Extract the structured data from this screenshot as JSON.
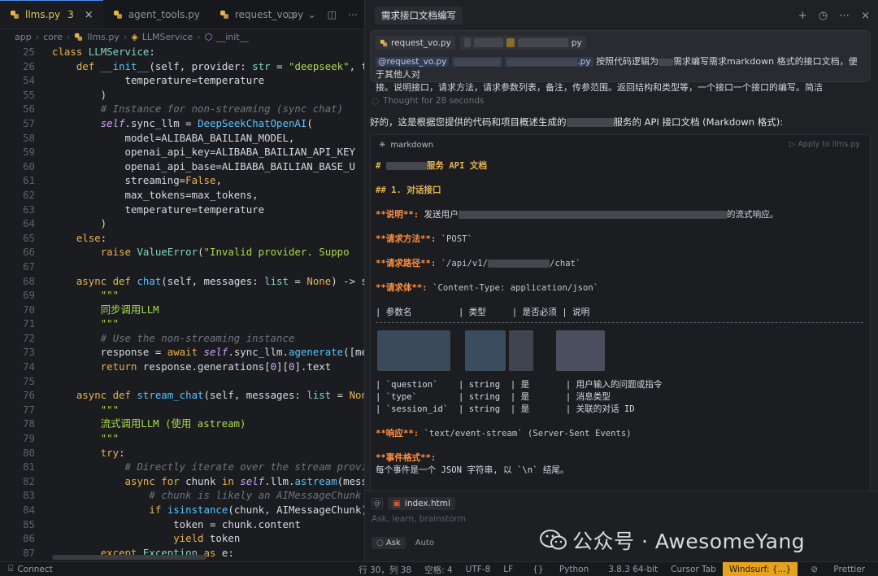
{
  "editor": {
    "tabs": [
      {
        "label": "llms.py",
        "badge": "3",
        "active": true
      },
      {
        "label": "agent_tools.py",
        "active": false
      },
      {
        "label": "request_vo.py",
        "active": false
      }
    ],
    "breadcrumb": [
      "app",
      "core",
      "llms.py",
      "LLMService",
      "__init__"
    ],
    "lines": [
      {
        "n": "25",
        "html": "<span class='kw'>class</span> <span class='cls'>LLMService</span>:"
      },
      {
        "n": "26",
        "html": "    <span class='kw'>def</span> <span class='fn'>__init__</span>(self, provider: <span class='cls'>str</span> = <span class='str'>\"deepseek\"</span>, t"
      },
      {
        "n": "54",
        "html": "            temperature=temperature"
      },
      {
        "n": "55",
        "html": "        )"
      },
      {
        "n": "56",
        "html": "        <span class='cm'># Instance for non-streaming (sync chat)</span>"
      },
      {
        "n": "57",
        "html": "        <span class='self'>self</span>.sync_llm = <span class='fn'>DeepSeekChatOpenAI</span>("
      },
      {
        "n": "58",
        "html": "            model=ALIBABA_BAILIAN_MODEL,"
      },
      {
        "n": "59",
        "html": "            openai_api_key=ALIBABA_BAILIAN_API_KEY"
      },
      {
        "n": "60",
        "html": "            openai_api_base=ALIBABA_BAILIAN_BASE_U"
      },
      {
        "n": "61",
        "html": "            streaming=<span class='bl'>False</span>,"
      },
      {
        "n": "62",
        "html": "            max_tokens=max_tokens,"
      },
      {
        "n": "63",
        "html": "            temperature=temperature"
      },
      {
        "n": "64",
        "html": "        )"
      },
      {
        "n": "65",
        "html": "    <span class='kw'>else</span>:"
      },
      {
        "n": "66",
        "html": "        <span class='kw'>raise</span> <span class='cls'>ValueError</span>(<span class='str'>\"Invalid provider. Suppo</span>"
      },
      {
        "n": "67",
        "html": ""
      },
      {
        "n": "68",
        "html": "    <span class='kw'>async def</span> <span class='fn'>chat</span>(self, messages: <span class='cls'>list</span> = <span class='bl'>None</span>) -&gt; st"
      },
      {
        "n": "69",
        "html": "        <span class='str'>\"\"\"</span>"
      },
      {
        "n": "70",
        "html": "        <span class='str'>同步调用LLM</span>"
      },
      {
        "n": "71",
        "html": "        <span class='str'>\"\"\"</span>"
      },
      {
        "n": "72",
        "html": "        <span class='cm'># Use the non-streaming instance</span>"
      },
      {
        "n": "73",
        "html": "        response = <span class='kw'>await</span> <span class='self'>self</span>.sync_llm.<span class='fn'>agenerate</span>([mes"
      },
      {
        "n": "74",
        "html": "        <span class='kw'>return</span> response.generations[<span class='num'>0</span>][<span class='num'>0</span>].text"
      },
      {
        "n": "75",
        "html": ""
      },
      {
        "n": "76",
        "html": "    <span class='kw'>async def</span> <span class='fn'>stream_chat</span>(self, messages: <span class='cls'>list</span> = <span class='bl'>None</span>"
      },
      {
        "n": "77",
        "html": "        <span class='str'>\"\"\"</span>"
      },
      {
        "n": "78",
        "html": "        <span class='str'>流式调用LLM (使用 astream)</span>"
      },
      {
        "n": "79",
        "html": "        <span class='str'>\"\"\"</span>"
      },
      {
        "n": "80",
        "html": "        <span class='kw'>try</span>:"
      },
      {
        "n": "81",
        "html": "            <span class='cm'># Directly iterate over the stream provid</span>"
      },
      {
        "n": "82",
        "html": "            <span class='kw'>async for</span> chunk <span class='kw'>in</span> <span class='self'>self</span>.llm.<span class='fn'>astream</span>(messag"
      },
      {
        "n": "83",
        "html": "                <span class='cm'># chunk is likely an AIMessageChunk w</span>"
      },
      {
        "n": "84",
        "html": "                <span class='kw'>if</span> <span class='fn'>isinstance</span>(chunk, AIMessageChunk) a"
      },
      {
        "n": "85",
        "html": "                    token = chunk.content"
      },
      {
        "n": "86",
        "html": "                    <span class='kw'>yield</span> token"
      },
      {
        "n": "87",
        "html": "        <span class='kw'>except</span> <span class='cls'>Exception</span> <span class='kw'>as</span> e:"
      }
    ]
  },
  "chat": {
    "title": "需求接口文档编写",
    "user_message": {
      "chip1": "request_vo.py",
      "chip2_suffix": "py",
      "mention1": "@request_vo.py",
      "mention3_suffix": ".py",
      "text_part1": "按照代码逻辑为",
      "text_part2": "需求编写需求markdown 格式的接口文档，便于其他人对",
      "text_line2": "接。说明接口，请求方法，请求参数列表，备注，传参范围。返回结构和类型等，一个接口一个接口的编写。简洁"
    },
    "thought": "Thought for 28 seconds",
    "answer_intro_a": "好的，这是根据您提供的代码和项目概述生成的",
    "answer_intro_b": "服务的 API 接口文档 (Markdown 格式):",
    "code_block": {
      "lang": "markdown",
      "apply": "Apply to llms.py",
      "h1_prefix": "#",
      "h1_suffix": "服务 API 文档",
      "h2": "## 1. 对话接口",
      "desc_label": "**说明**:",
      "desc_a": "发送用户",
      "desc_b": "的流式响应。",
      "method_label": "**请求方法**:",
      "method": "`POST`",
      "path_label": "**请求路径**:",
      "path_a": "`/api/v1/",
      "path_b": "/chat`",
      "body_label": "**请求体**:",
      "body": "`Content-Type: application/json`",
      "table_header": "| 参数名         | 类型     | 是否必须 | 说明",
      "rows": [
        "| `question`    | string  | 是       | 用户输入的问题或指令",
        "| `type`        | string  | 是       | 消息类型",
        "| `session_id`  | string  | 是       | 关联的对话 ID"
      ],
      "resp_label": "**响应**:",
      "resp": "`text/event-stream` (Server-Sent Events)",
      "event_label": "**事件格式**:",
      "event_text": "每个事件是一个 JSON 字符串, 以 `\\n` 结尾。"
    },
    "input": {
      "file": "index.html",
      "placeholder": "Ask, learn, brainstorm",
      "mode": "Ask",
      "model": "Auto"
    }
  },
  "watermark": "公众号 · AwesomeYang",
  "status": {
    "left": "Connect",
    "cursor": "行 30，列 38",
    "spaces": "空格: 4",
    "encoding": "UTF-8",
    "eol": "LF",
    "language": "Python",
    "interpreter": "3.8.3 64-bit",
    "cursor_tab": "Cursor Tab",
    "windsurf": "Windsurf: {...}",
    "prettier": "Prettier"
  }
}
